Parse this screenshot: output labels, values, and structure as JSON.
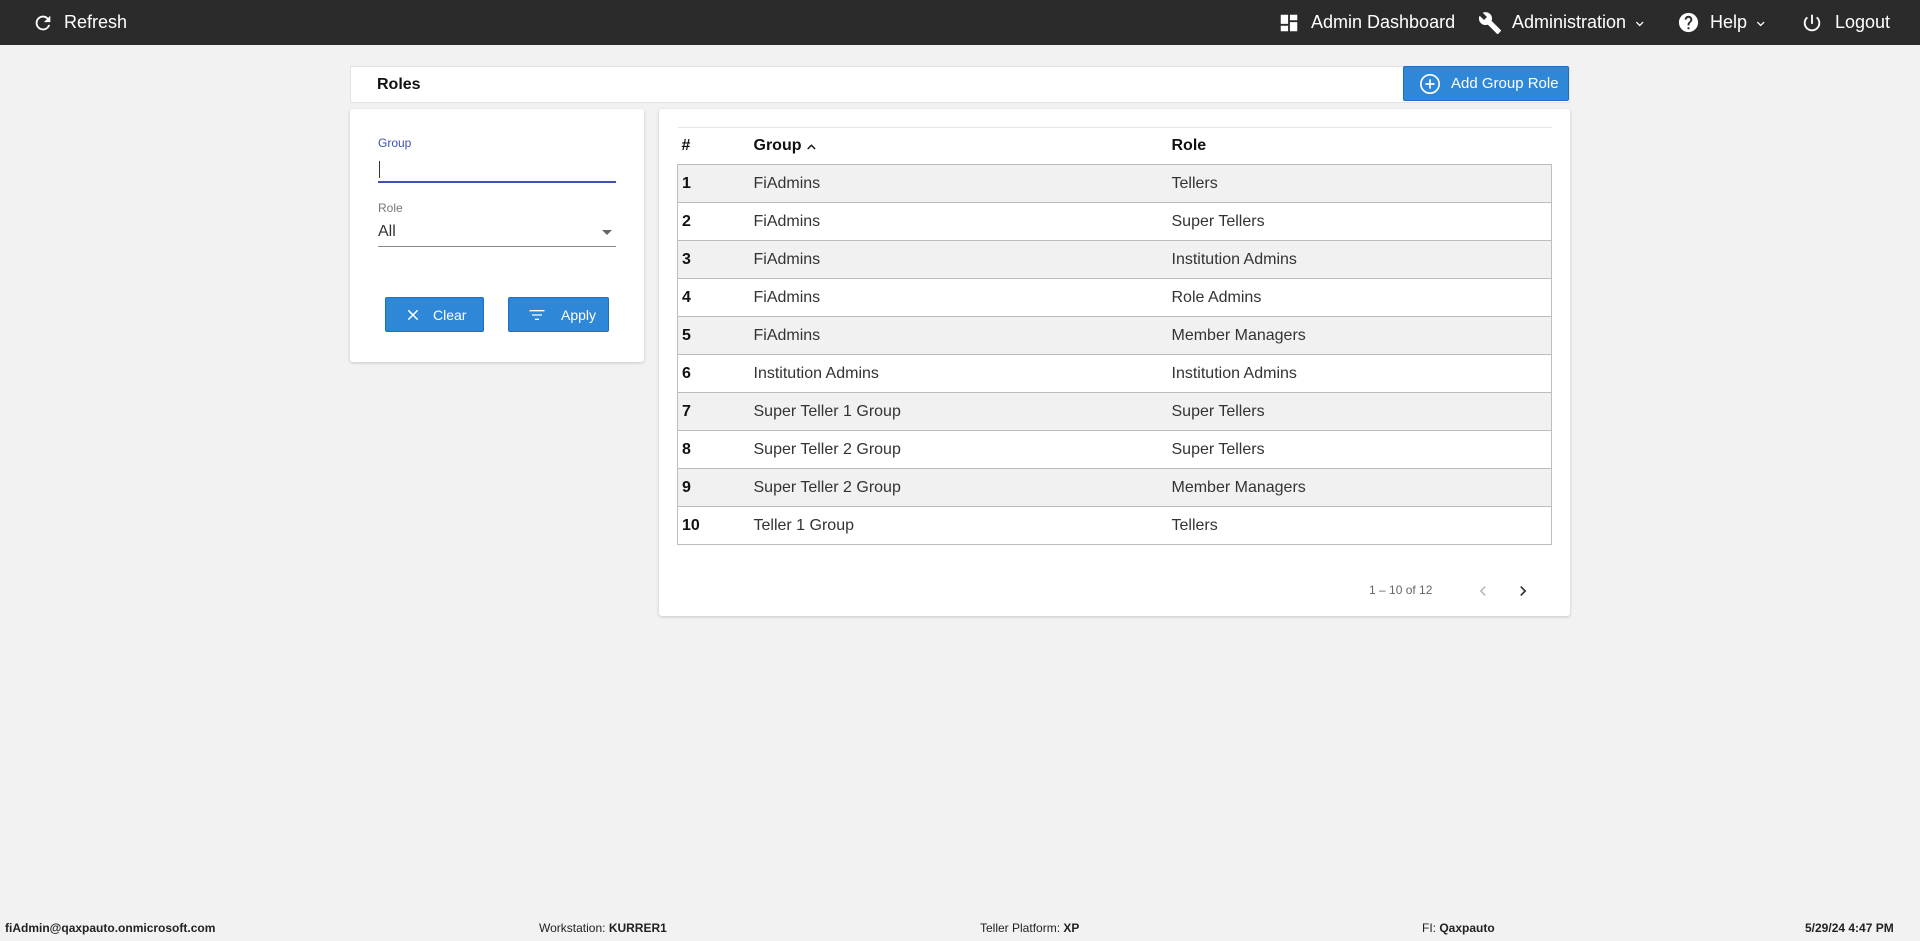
{
  "topbar": {
    "refresh": "Refresh",
    "dashboard": "Admin Dashboard",
    "administration": "Administration",
    "help": "Help",
    "logout": "Logout"
  },
  "page": {
    "title": "Roles",
    "add_button": "Add Group Role"
  },
  "filters": {
    "group_label": "Group",
    "group_value": "",
    "role_label": "Role",
    "role_value": "All",
    "clear_label": "Clear",
    "apply_label": "Apply"
  },
  "table": {
    "headers": [
      "#",
      "Group",
      "Role"
    ],
    "sorted_by": "Group",
    "sort_direction": "ascending",
    "rows": [
      {
        "num": "1",
        "group": "FiAdmins",
        "role": "Tellers"
      },
      {
        "num": "2",
        "group": "FiAdmins",
        "role": "Super Tellers"
      },
      {
        "num": "3",
        "group": "FiAdmins",
        "role": "Institution Admins"
      },
      {
        "num": "4",
        "group": "FiAdmins",
        "role": "Role Admins"
      },
      {
        "num": "5",
        "group": "FiAdmins",
        "role": "Member Managers"
      },
      {
        "num": "6",
        "group": "Institution Admins",
        "role": "Institution Admins"
      },
      {
        "num": "7",
        "group": "Super Teller 1 Group",
        "role": "Super Tellers"
      },
      {
        "num": "8",
        "group": "Super Teller 2 Group",
        "role": "Super Tellers"
      },
      {
        "num": "9",
        "group": "Super Teller 2 Group",
        "role": "Member Managers"
      },
      {
        "num": "10",
        "group": "Teller 1 Group",
        "role": "Tellers"
      }
    ]
  },
  "pagination": {
    "range": "1 – 10 of 12"
  },
  "statusbar": {
    "user": "fiAdmin@qaxpauto.onmicrosoft.com",
    "workstation_label": "Workstation:",
    "workstation_value": "KURRER1",
    "platform_label": "Teller Platform:",
    "platform_value": "XP",
    "fi_label": "FI:",
    "fi_value": "Qaxpauto",
    "datetime": "5/29/24 4:47 PM"
  },
  "colors": {
    "topbar_bg": "#2b2b2b",
    "primary_button": "#2f87d8",
    "focus_underline": "#3f51b5",
    "page_bg": "#f2f2f2"
  },
  "icons": {
    "refresh": "refresh-icon",
    "dashboard": "dashboard-icon",
    "administration": "wrench-icon",
    "help": "help-circle-icon",
    "logout": "power-icon",
    "add": "plus-circle-icon",
    "clear": "close-icon",
    "apply": "filter-icon",
    "sort": "sort-ascending-icon",
    "prev": "chevron-left-icon",
    "next": "chevron-right-icon"
  }
}
